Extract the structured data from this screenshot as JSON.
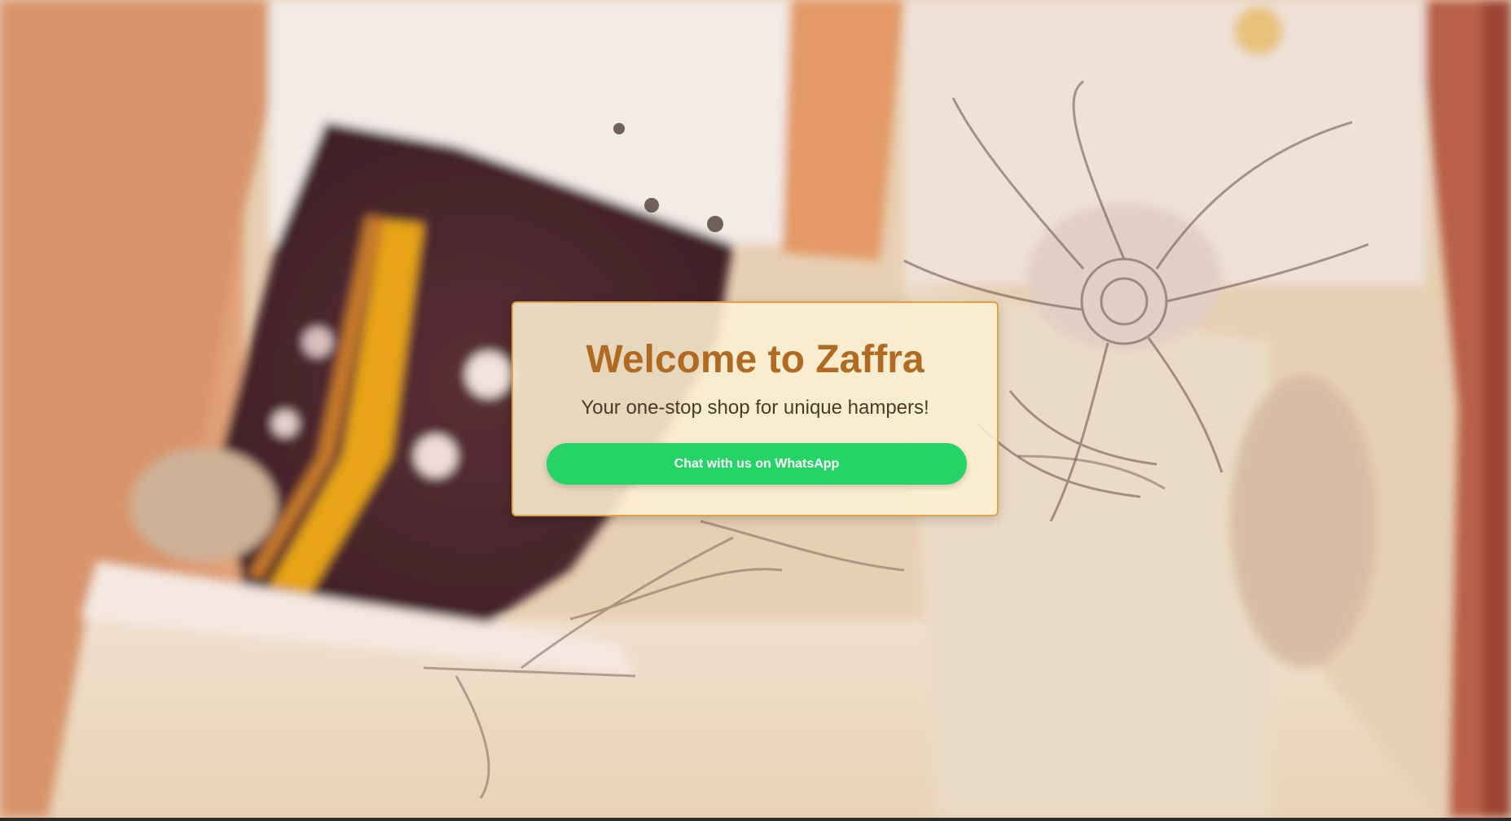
{
  "hero": {
    "background_description": "",
    "accent_color": "#b06a22",
    "border_color": "#e0a14a"
  },
  "welcome": {
    "title": "Welcome to Zaffra",
    "subtitle": "Your one-stop shop for unique hampers!",
    "cta_label": "Chat with us on WhatsApp",
    "cta_color": "#25d366"
  }
}
